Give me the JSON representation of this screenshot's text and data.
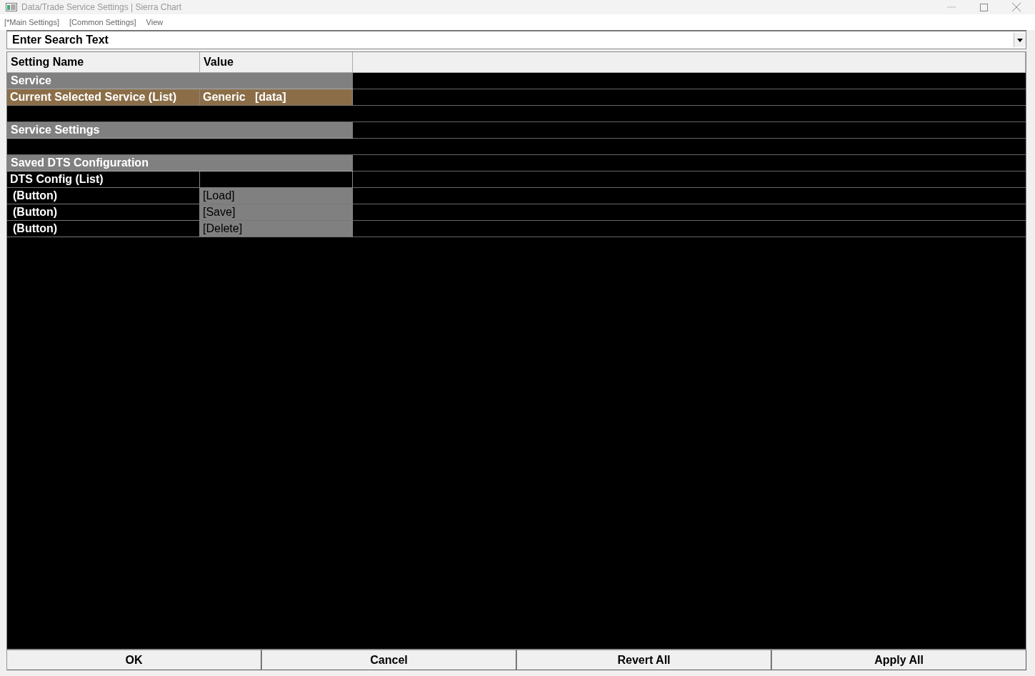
{
  "window": {
    "title": "Data/Trade Service Settings | Sierra Chart"
  },
  "menu": [
    {
      "label": "[*Main Settings]"
    },
    {
      "label": "[Common Settings]"
    },
    {
      "label": "View"
    }
  ],
  "search": {
    "value": "Enter Search Text"
  },
  "table": {
    "columns": [
      "Setting Name",
      "Value"
    ],
    "rows": [
      {
        "kind": "section",
        "name": "Service",
        "selected": false
      },
      {
        "kind": "setting",
        "name": "Current Selected Service (List)",
        "value": "Generic   [data]",
        "selected": true
      },
      {
        "kind": "blank",
        "selected": false
      },
      {
        "kind": "section",
        "name": "Service Settings",
        "selected": false
      },
      {
        "kind": "blank",
        "selected": false
      },
      {
        "kind": "section",
        "name": "Saved DTS Configuration",
        "selected": false
      },
      {
        "kind": "setting",
        "name": "DTS Config (List)",
        "selected": false
      },
      {
        "kind": "button",
        "name": "(Button)",
        "value": "[Load]",
        "selected": false
      },
      {
        "kind": "button",
        "name": "(Button)",
        "value": "[Save]",
        "selected": false
      },
      {
        "kind": "button",
        "name": "(Button)",
        "value": "[Delete]",
        "selected": false
      }
    ]
  },
  "buttons": [
    "OK",
    "Cancel",
    "Revert All",
    "Apply All"
  ]
}
